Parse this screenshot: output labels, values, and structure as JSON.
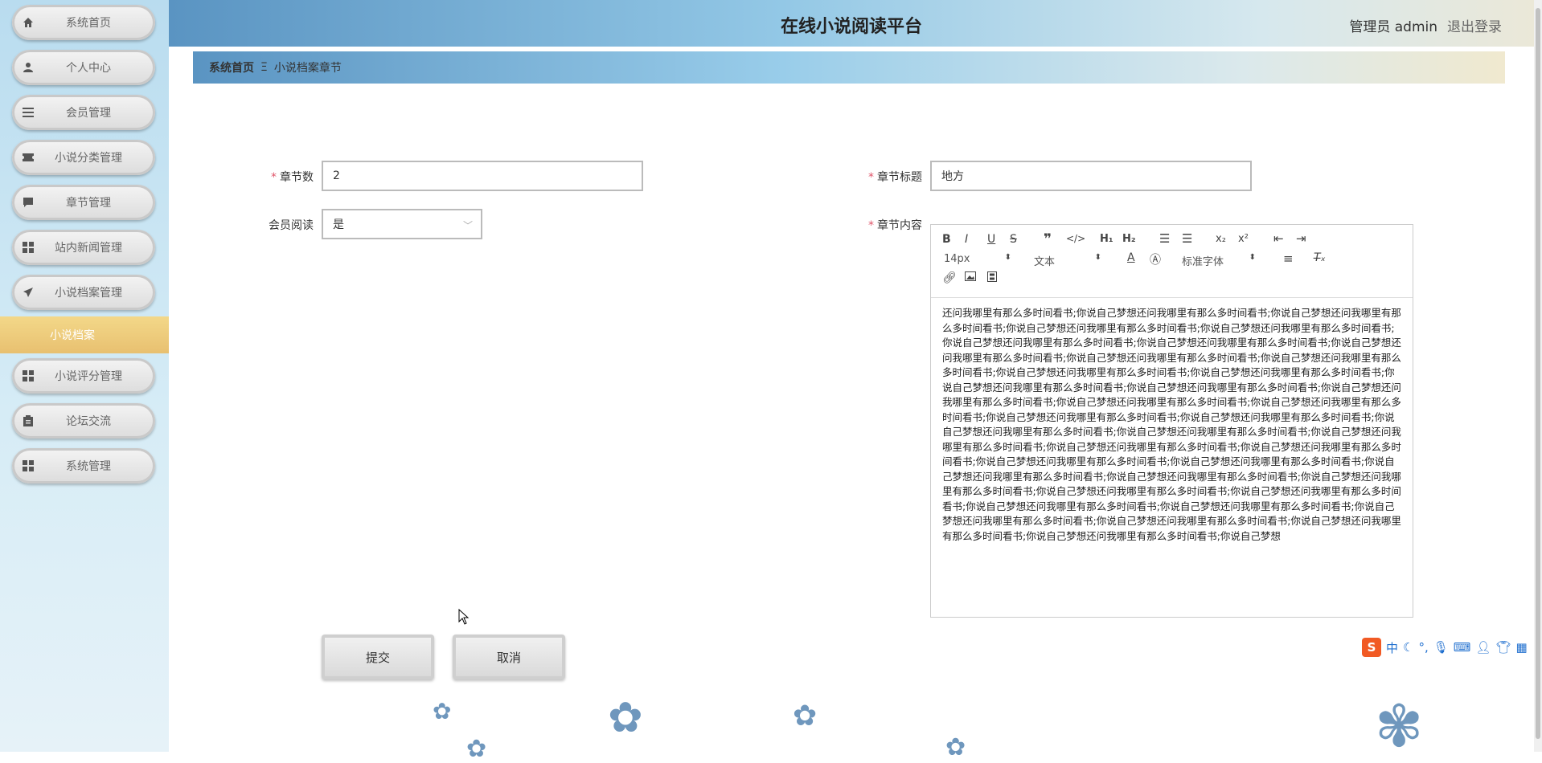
{
  "header": {
    "title": "在线小说阅读平台",
    "user": "管理员 admin",
    "logout": "退出登录"
  },
  "sidebar": {
    "items": [
      {
        "label": "系统首页",
        "icon": "home-icon"
      },
      {
        "label": "个人中心",
        "icon": "user-icon"
      },
      {
        "label": "会员管理",
        "icon": "menu-icon"
      },
      {
        "label": "小说分类管理",
        "icon": "ticket-icon"
      },
      {
        "label": "章节管理",
        "icon": "chat-icon"
      },
      {
        "label": "站内新闻管理",
        "icon": "grid-icon"
      },
      {
        "label": "小说档案管理",
        "icon": "send-icon"
      },
      {
        "label": "小说评分管理",
        "icon": "grid-icon"
      },
      {
        "label": "论坛交流",
        "icon": "clipboard-icon"
      },
      {
        "label": "系统管理",
        "icon": "grid-icon"
      }
    ],
    "active_sub": "小说档案"
  },
  "breadcrumb": {
    "home": "系统首页",
    "separator": "Ξ",
    "current": "小说档案章节"
  },
  "form": {
    "chapter_num": {
      "label": "章节数",
      "value": "2"
    },
    "chapter_title": {
      "label": "章节标题",
      "value": "地方"
    },
    "member_read": {
      "label": "会员阅读",
      "value": "是"
    },
    "chapter_content": {
      "label": "章节内容"
    }
  },
  "editor": {
    "font_size": "14px",
    "paragraph": "文本",
    "font_family": "标准字体",
    "content": "还问我哪里有那么多时间看书;你说自己梦想还问我哪里有那么多时间看书;你说自己梦想还问我哪里有那么多时间看书;你说自己梦想还问我哪里有那么多时间看书;你说自己梦想还问我哪里有那么多时间看书;你说自己梦想还问我哪里有那么多时间看书;你说自己梦想还问我哪里有那么多时间看书;你说自己梦想还问我哪里有那么多时间看书;你说自己梦想还问我哪里有那么多时间看书;你说自己梦想还问我哪里有那么多时间看书;你说自己梦想还问我哪里有那么多时间看书;你说自己梦想还问我哪里有那么多时间看书;你说自己梦想还问我哪里有那么多时间看书;你说自己梦想还问我哪里有那么多时间看书;你说自己梦想还问我哪里有那么多时间看书;你说自己梦想还问我哪里有那么多时间看书;你说自己梦想还问我哪里有那么多时间看书;你说自己梦想还问我哪里有那么多时间看书;你说自己梦想还问我哪里有那么多时间看书;你说自己梦想还问我哪里有那么多时间看书;你说自己梦想还问我哪里有那么多时间看书;你说自己梦想还问我哪里有那么多时间看书;你说自己梦想还问我哪里有那么多时间看书;你说自己梦想还问我哪里有那么多时间看书;你说自己梦想还问我哪里有那么多时间看书;你说自己梦想还问我哪里有那么多时间看书;你说自己梦想还问我哪里有那么多时间看书;你说自己梦想还问我哪里有那么多时间看书;你说自己梦想还问我哪里有那么多时间看书;你说自己梦想还问我哪里有那么多时间看书;你说自己梦想还问我哪里有那么多时间看书;你说自己梦想还问我哪里有那么多时间看书;你说自己梦想还问我哪里有那么多时间看书;你说自己梦想还问我哪里有那么多时间看书;你说自己梦想还问我哪里有那么多时间看书;你说自己梦想还问我哪里有那么多时间看书;你说自己梦想还问我哪里有那么多时间看书;你说自己梦想"
  },
  "buttons": {
    "submit": "提交",
    "cancel": "取消"
  },
  "ime": {
    "lang": "中"
  }
}
